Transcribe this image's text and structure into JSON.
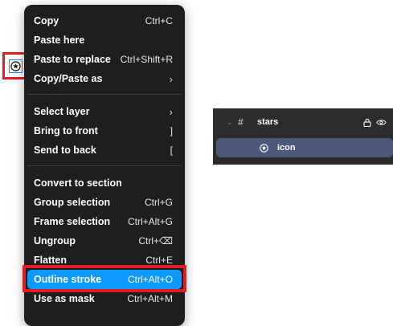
{
  "menu": {
    "groups": [
      [
        {
          "label": "Copy",
          "shortcut": "Ctrl+C"
        },
        {
          "label": "Paste here",
          "shortcut": ""
        },
        {
          "label": "Paste to replace",
          "shortcut": "Ctrl+Shift+R"
        },
        {
          "label": "Copy/Paste as",
          "shortcut": "›"
        }
      ],
      [
        {
          "label": "Select layer",
          "shortcut": "›"
        },
        {
          "label": "Bring to front",
          "shortcut": "]"
        },
        {
          "label": "Send to back",
          "shortcut": "["
        }
      ],
      [
        {
          "label": "Convert to section",
          "shortcut": ""
        },
        {
          "label": "Group selection",
          "shortcut": "Ctrl+G"
        },
        {
          "label": "Frame selection",
          "shortcut": "Ctrl+Alt+G"
        },
        {
          "label": "Ungroup",
          "shortcut": "Ctrl+⌫"
        },
        {
          "label": "Flatten",
          "shortcut": "Ctrl+E"
        },
        {
          "label": "Outline stroke",
          "shortcut": "Ctrl+Alt+O"
        },
        {
          "label": "Use as mask",
          "shortcut": "Ctrl+Alt+M"
        }
      ]
    ],
    "highlighted": "Outline stroke"
  },
  "layers": {
    "frame_name": "stars",
    "child_name": "icon"
  },
  "colors": {
    "menu_bg": "#1e1e1e",
    "highlight": "#0d99ff",
    "annotation_red": "#e31b23",
    "layers_bg": "#2c2c2c",
    "selected_layer_bg": "#4c5878"
  },
  "icons": [
    "star-outline-icon",
    "chevron-right-icon",
    "frame-hash-icon",
    "lock-icon",
    "eye-icon",
    "caret-down-icon"
  ]
}
